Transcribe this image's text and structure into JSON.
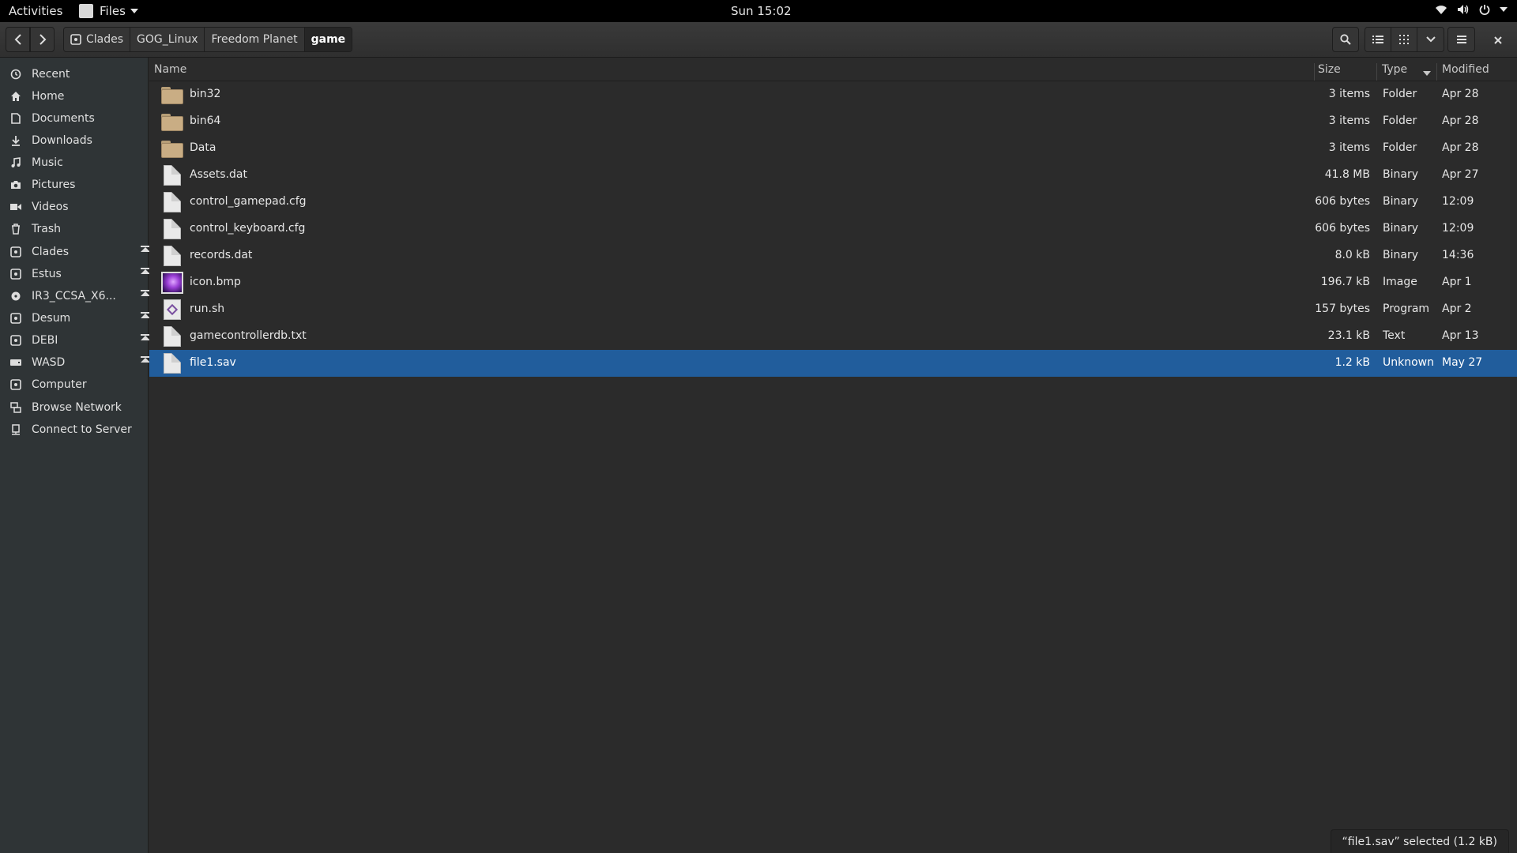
{
  "topbar": {
    "activities": "Activities",
    "app_menu": "Files",
    "clock": "Sun 15:02",
    "icons": [
      "wifi-icon",
      "volume-icon",
      "power-icon"
    ]
  },
  "header": {
    "breadcrumbs": [
      {
        "label": "Clades",
        "icon": "drive-icon"
      },
      {
        "label": "GOG_Linux"
      },
      {
        "label": "Freedom Planet"
      },
      {
        "label": "game"
      }
    ]
  },
  "sidebar": {
    "items": [
      {
        "label": "Recent",
        "icon": "clock-icon"
      },
      {
        "label": "Home",
        "icon": "home-icon"
      },
      {
        "label": "Documents",
        "icon": "document-icon"
      },
      {
        "label": "Downloads",
        "icon": "download-icon"
      },
      {
        "label": "Music",
        "icon": "music-icon"
      },
      {
        "label": "Pictures",
        "icon": "camera-icon"
      },
      {
        "label": "Videos",
        "icon": "video-icon"
      },
      {
        "label": "Trash",
        "icon": "trash-icon"
      },
      {
        "label": "Clades",
        "icon": "drive-icon",
        "eject": true
      },
      {
        "label": "Estus",
        "icon": "drive-icon",
        "eject": true
      },
      {
        "label": "IR3_CCSA_X6...",
        "icon": "disc-icon",
        "eject": true
      },
      {
        "label": "Desum",
        "icon": "drive-icon",
        "eject": true
      },
      {
        "label": "DEBI",
        "icon": "drive-icon",
        "eject": true
      },
      {
        "label": "WASD",
        "icon": "usb-drive-icon",
        "eject": true
      },
      {
        "label": "Computer",
        "icon": "drive-icon"
      },
      {
        "label": "Browse Network",
        "icon": "network-icon"
      },
      {
        "label": "Connect to Server",
        "icon": "server-icon"
      }
    ]
  },
  "columns": {
    "name": "Name",
    "size": "Size",
    "type": "Type",
    "modified": "Modified"
  },
  "files": [
    {
      "name": "bin32",
      "size": "3 items",
      "type": "Folder",
      "modified": "Apr 28",
      "icon": "folder"
    },
    {
      "name": "bin64",
      "size": "3 items",
      "type": "Folder",
      "modified": "Apr 28",
      "icon": "folder"
    },
    {
      "name": "Data",
      "size": "3 items",
      "type": "Folder",
      "modified": "Apr 28",
      "icon": "folder"
    },
    {
      "name": "Assets.dat",
      "size": "41.8 MB",
      "type": "Binary",
      "modified": "Apr 27",
      "icon": "file"
    },
    {
      "name": "control_gamepad.cfg",
      "size": "606 bytes",
      "type": "Binary",
      "modified": "12:09",
      "icon": "file"
    },
    {
      "name": "control_keyboard.cfg",
      "size": "606 bytes",
      "type": "Binary",
      "modified": "12:09",
      "icon": "file"
    },
    {
      "name": "records.dat",
      "size": "8.0 kB",
      "type": "Binary",
      "modified": "14:36",
      "icon": "file"
    },
    {
      "name": "icon.bmp",
      "size": "196.7 kB",
      "type": "Image",
      "modified": "Apr 1",
      "icon": "image"
    },
    {
      "name": "run.sh",
      "size": "157 bytes",
      "type": "Program",
      "modified": "Apr 2",
      "icon": "script"
    },
    {
      "name": "gamecontrollerdb.txt",
      "size": "23.1 kB",
      "type": "Text",
      "modified": "Apr 13",
      "icon": "file"
    },
    {
      "name": "file1.sav",
      "size": "1.2 kB",
      "type": "Unknown",
      "modified": "May 27",
      "icon": "file",
      "selected": true
    }
  ],
  "status": "“file1.sav” selected  (1.2 kB)",
  "colors": {
    "selection": "#215d9c",
    "sidebar": "#2f3436",
    "background": "#2b2b2b"
  }
}
